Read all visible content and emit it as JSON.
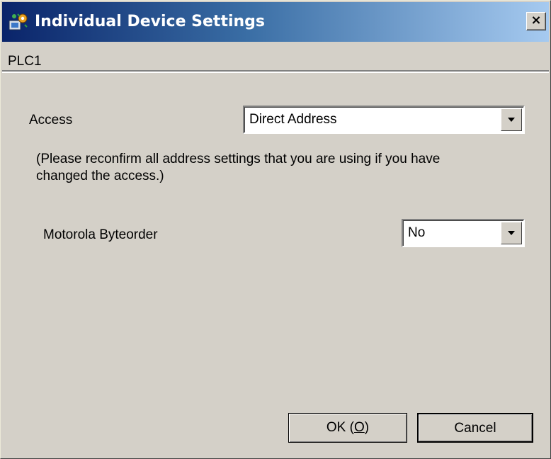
{
  "window": {
    "title": "Individual Device Settings",
    "close_glyph": "×",
    "icon": "device-settings-icon"
  },
  "device": {
    "name": "PLC1"
  },
  "access": {
    "label": "Access",
    "selected": "Direct Address"
  },
  "note": {
    "text": "(Please reconfirm all address settings that you are using if you have changed the access.)"
  },
  "byteorder": {
    "label": "Motorola Byteorder",
    "selected": "No"
  },
  "buttons": {
    "ok_prefix": "OK (",
    "ok_accel": "O",
    "ok_suffix": ")",
    "cancel": "Cancel"
  },
  "colors": {
    "titlebar_start": "#0a246a",
    "titlebar_end": "#a6caf0",
    "face": "#d4d0c8"
  }
}
